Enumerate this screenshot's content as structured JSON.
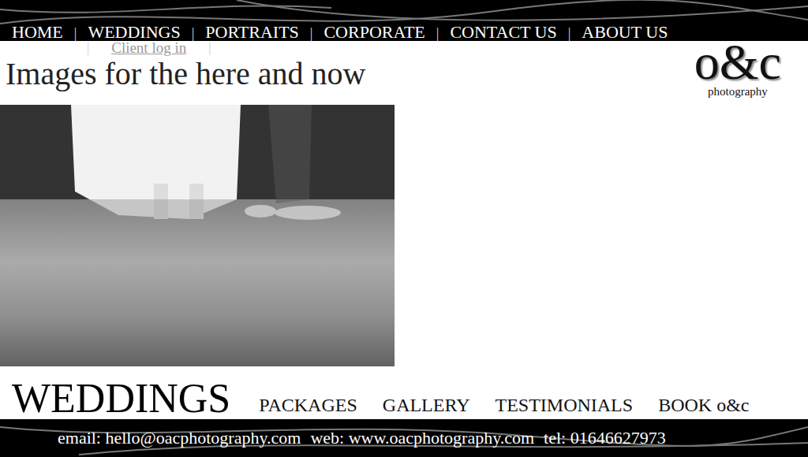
{
  "nav": {
    "items": [
      "HOME",
      "WEDDINGS",
      "PORTRAITS",
      "CORPORATE",
      "CONTACT US",
      "ABOUT US"
    ],
    "separator": "|"
  },
  "client_login": "Client log in",
  "tagline": "Images for the here and now",
  "logo": {
    "mark": "o&c",
    "sub": "photography"
  },
  "section": {
    "title": "WEDDINGS",
    "links": [
      "PACKAGES",
      "GALLERY",
      "TESTIMONIALS",
      "BOOK o&c"
    ]
  },
  "footer": [
    "email: hello@oacphotography.com",
    "web: www.oacphotography.com",
    "tel: 01646627973"
  ]
}
